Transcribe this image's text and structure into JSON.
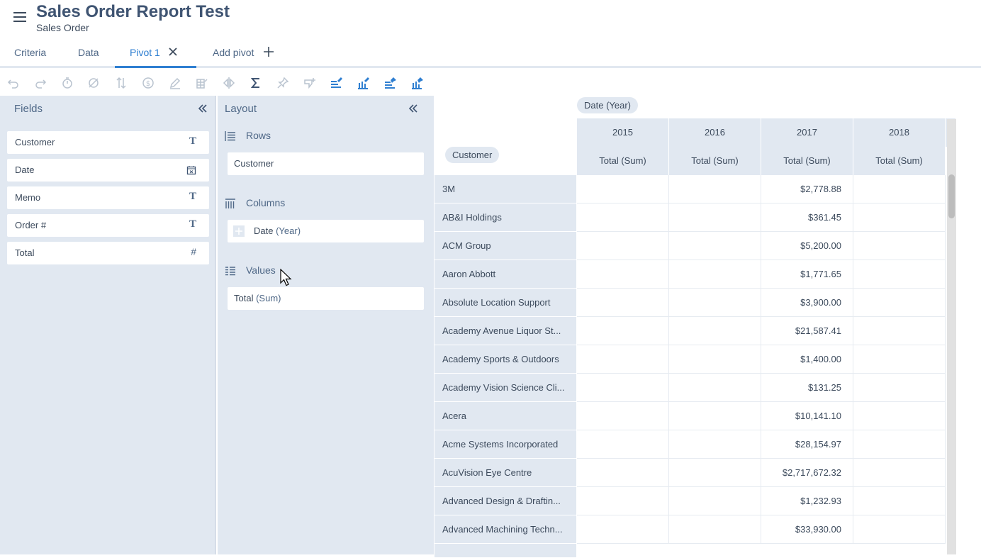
{
  "header": {
    "title": "Sales Order Report Test",
    "subtitle": "Sales Order"
  },
  "tabs": [
    {
      "label": "Criteria"
    },
    {
      "label": "Data"
    },
    {
      "label": "Pivot 1"
    },
    {
      "label": "Add pivot"
    }
  ],
  "toolbar": {
    "icons": [
      "undo-icon",
      "redo-icon",
      "timer-icon",
      "clear-icon",
      "sort-icon",
      "currency-icon",
      "edit-icon",
      "grid-format-icon",
      "compare-icon",
      "sum-icon",
      "pin-icon",
      "add-filter-icon",
      "pinned-rows-icon",
      "pinned-columns-icon",
      "pin-rows-icon",
      "pin-columns-icon"
    ]
  },
  "fields_panel": {
    "title": "Fields",
    "items": [
      {
        "name": "Customer",
        "type": "T"
      },
      {
        "name": "Date",
        "type": "calendar"
      },
      {
        "name": "Memo",
        "type": "T"
      },
      {
        "name": "Order #",
        "type": "T"
      },
      {
        "name": "Total",
        "type": "#"
      }
    ]
  },
  "layout_panel": {
    "title": "Layout",
    "rows_label": "Rows",
    "rows_item": "Customer",
    "columns_label": "Columns",
    "columns_item": "Date",
    "columns_item_sub": "(Year)",
    "values_label": "Values",
    "values_item": "Total",
    "values_item_sub": "(Sum)"
  },
  "pivot": {
    "column_pill": "Date (Year)",
    "row_pill": "Customer",
    "years": [
      "2015",
      "2016",
      "2017",
      "2018"
    ],
    "measure": "Total (Sum)",
    "rows": [
      {
        "customer": "3M",
        "v2017": "$2,778.88"
      },
      {
        "customer": "AB&I Holdings",
        "v2017": "$361.45"
      },
      {
        "customer": "ACM Group",
        "v2017": "$5,200.00"
      },
      {
        "customer": "Aaron Abbott",
        "v2017": "$1,771.65"
      },
      {
        "customer": "Absolute Location Support",
        "v2017": "$3,900.00"
      },
      {
        "customer": "Academy Avenue Liquor St...",
        "v2017": "$21,587.41"
      },
      {
        "customer": "Academy Sports & Outdoors",
        "v2017": "$1,400.00"
      },
      {
        "customer": "Academy Vision Science Cli...",
        "v2017": "$131.25"
      },
      {
        "customer": "Acera",
        "v2017": "$10,141.10"
      },
      {
        "customer": "Acme Systems Incorporated",
        "v2017": "$28,154.97"
      },
      {
        "customer": "AcuVision Eye Centre",
        "v2017": "$2,717,672.32"
      },
      {
        "customer": "Advanced Design & Draftin...",
        "v2017": "$1,232.93"
      },
      {
        "customer": "Advanced Machining Techn...",
        "v2017": "$33,930.00"
      }
    ]
  },
  "colors": {
    "accent": "#2f7fd1",
    "panel": "#e1e8f1",
    "title": "#3f5472"
  }
}
